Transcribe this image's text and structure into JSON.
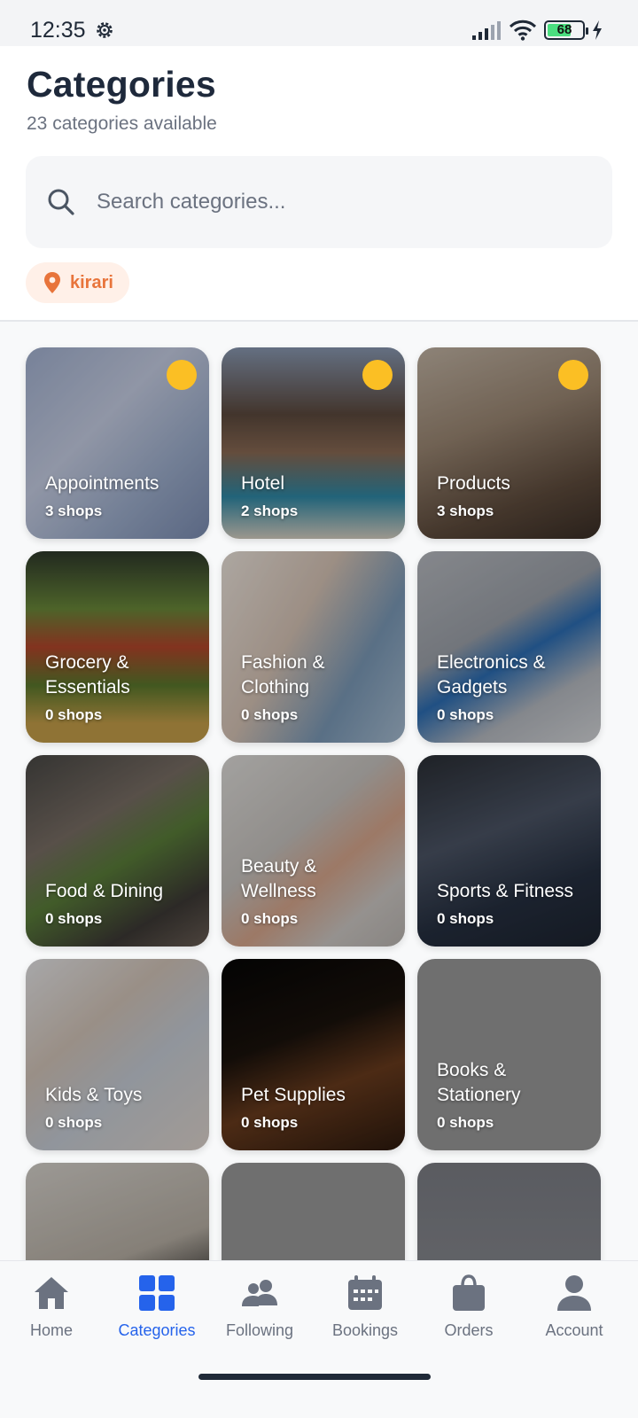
{
  "status_bar": {
    "time": "12:35",
    "battery": "68",
    "battery_level": 0.68
  },
  "header": {
    "title": "Categories",
    "subtitle": "23 categories available"
  },
  "search": {
    "placeholder": "Search categories...",
    "value": ""
  },
  "location": {
    "label": "kirari",
    "icon": "map-pin-icon"
  },
  "colors": {
    "accent": "#2563eb",
    "location": "#e8743b",
    "badge": "#fbbf24",
    "title": "#1e293b"
  },
  "categories": [
    {
      "name": "Appointments",
      "count": "3 shops",
      "badge": true
    },
    {
      "name": "Hotel",
      "count": "2 shops",
      "badge": true
    },
    {
      "name": "Products",
      "count": "3 shops",
      "badge": true
    },
    {
      "name": "Grocery & Essentials",
      "count": "0 shops",
      "badge": false
    },
    {
      "name": "Fashion & Clothing",
      "count": "0 shops",
      "badge": false
    },
    {
      "name": "Electronics & Gadgets",
      "count": "0 shops",
      "badge": false
    },
    {
      "name": "Food & Dining",
      "count": "0 shops",
      "badge": false
    },
    {
      "name": "Beauty & Wellness",
      "count": "0 shops",
      "badge": false
    },
    {
      "name": "Sports & Fitness",
      "count": "0 shops",
      "badge": false
    },
    {
      "name": "Kids & Toys",
      "count": "0 shops",
      "badge": false
    },
    {
      "name": "Pet Supplies",
      "count": "0 shops",
      "badge": false
    },
    {
      "name": "Books & Stationery",
      "count": "0 shops",
      "badge": false
    }
  ],
  "nav": {
    "items": [
      {
        "label": "Home",
        "icon": "home-icon",
        "active": false
      },
      {
        "label": "Categories",
        "icon": "grid-icon",
        "active": true
      },
      {
        "label": "Following",
        "icon": "users-icon",
        "active": false
      },
      {
        "label": "Bookings",
        "icon": "calendar-icon",
        "active": false
      },
      {
        "label": "Orders",
        "icon": "bag-icon",
        "active": false
      },
      {
        "label": "Account",
        "icon": "person-icon",
        "active": false
      }
    ]
  }
}
